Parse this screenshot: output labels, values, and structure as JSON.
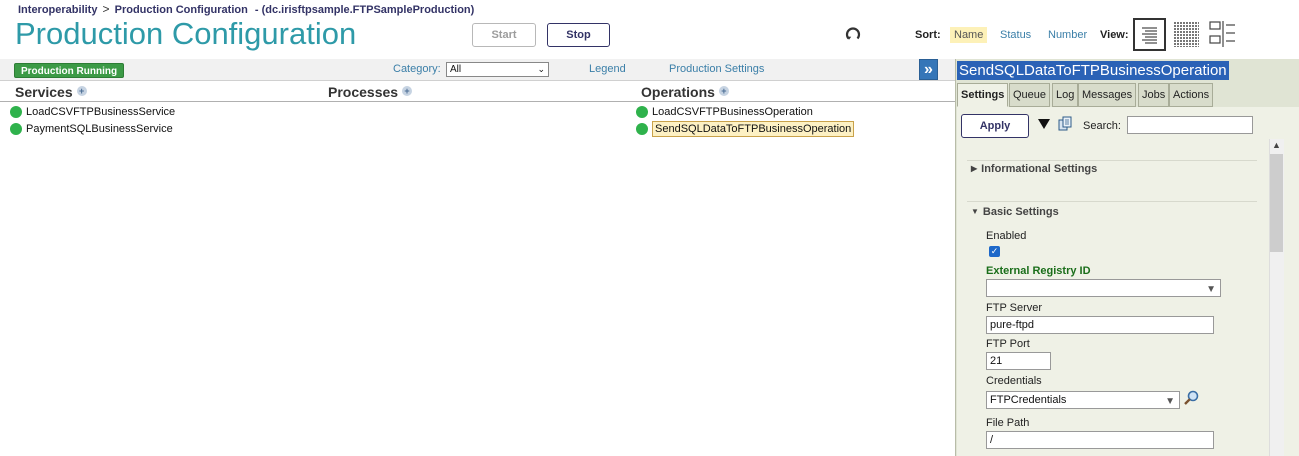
{
  "breadcrumb": {
    "root": "Interoperability",
    "separator": ">",
    "current": "Production Configuration",
    "namespace": "- (dc.irisftpsample.FTPSampleProduction)"
  },
  "header": {
    "title": "Production Configuration",
    "start_label": "Start",
    "stop_label": "Stop",
    "sort_label": "Sort:",
    "sort_options": [
      "Name",
      "Status",
      "Number"
    ],
    "selected_sort": "Name",
    "view_label": "View:"
  },
  "toolbar": {
    "status_badge": "Production Running",
    "category_label": "Category:",
    "category_value": "All",
    "legend_link": "Legend",
    "settings_link": "Production Settings",
    "expand_label": "»"
  },
  "columns": {
    "services": "Services",
    "processes": "Processes",
    "operations": "Operations"
  },
  "services": [
    {
      "name": "LoadCSVFTPBusinessService",
      "status_color": "#2fb24c"
    },
    {
      "name": "PaymentSQLBusinessService",
      "status_color": "#2fb24c"
    }
  ],
  "operations": [
    {
      "name": "LoadCSVFTPBusinessOperation",
      "status_color": "#2fb24c"
    },
    {
      "name": "SendSQLDataToFTPBusinessOperation",
      "status_color": "#2fb24c",
      "selected": true
    }
  ],
  "panel": {
    "title": "SendSQLDataToFTPBusinessOperation",
    "tabs": [
      "Settings",
      "Queue",
      "Log",
      "Messages",
      "Jobs",
      "Actions"
    ],
    "active_tab": "Settings",
    "apply_label": "Apply",
    "search_label": "Search:",
    "search_value": "",
    "sections": {
      "informational": "Informational Settings",
      "basic": "Basic Settings"
    },
    "fields": {
      "enabled_label": "Enabled",
      "enabled_checked": true,
      "external_registry_label": "External Registry ID",
      "external_registry_value": "",
      "ftp_server_label": "FTP Server",
      "ftp_server_value": "pure-ftpd",
      "ftp_port_label": "FTP Port",
      "ftp_port_value": "21",
      "credentials_label": "Credentials",
      "credentials_value": "FTPCredentials",
      "file_path_label": "File Path",
      "file_path_value": "/"
    }
  },
  "colors": {
    "title": "#2e9aa8",
    "running_badge": "#3c9a46",
    "status_ok": "#2fb24c",
    "panel_title_bg": "#2a62b6",
    "panel_bg": "#e0e4d4",
    "link": "#3b7fa8"
  },
  "icons": [
    "refresh-icon",
    "list-view-icon",
    "grid-view-icon",
    "split-view-icon",
    "expand-icon",
    "add-icon",
    "filter-icon",
    "copy-icon",
    "magnifier-icon",
    "chevron-down-icon"
  ]
}
